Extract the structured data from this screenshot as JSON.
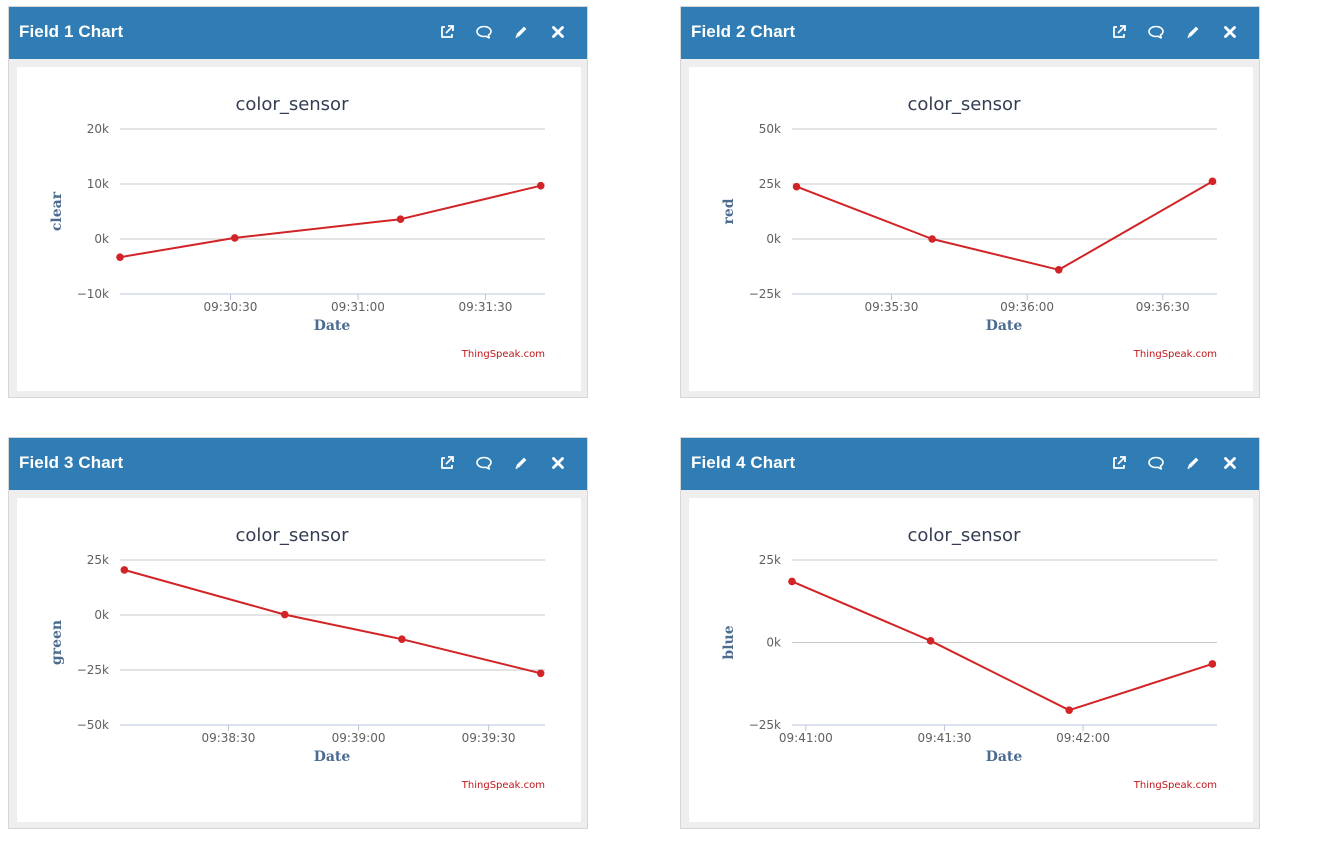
{
  "panels": [
    {
      "title": "Field 1 Chart",
      "actions": [
        {
          "icon": "external-link-icon"
        },
        {
          "icon": "comment-icon"
        },
        {
          "icon": "pencil-icon"
        },
        {
          "icon": "close-icon"
        }
      ]
    },
    {
      "title": "Field 2 Chart",
      "actions": [
        {
          "icon": "external-link-icon"
        },
        {
          "icon": "comment-icon"
        },
        {
          "icon": "pencil-icon"
        },
        {
          "icon": "close-icon"
        }
      ]
    },
    {
      "title": "Field 3 Chart",
      "actions": [
        {
          "icon": "external-link-icon"
        },
        {
          "icon": "comment-icon"
        },
        {
          "icon": "pencil-icon"
        },
        {
          "icon": "close-icon"
        }
      ]
    },
    {
      "title": "Field 4 Chart",
      "actions": [
        {
          "icon": "external-link-icon"
        },
        {
          "icon": "comment-icon"
        },
        {
          "icon": "pencil-icon"
        },
        {
          "icon": "close-icon"
        }
      ]
    }
  ],
  "colors": {
    "header": "#2f7db4",
    "series": "#d22327",
    "grid": "#c8c8c8",
    "credit": "#c0161a"
  },
  "chart_data": [
    {
      "type": "line",
      "title": "color_sensor",
      "xlabel": "Date",
      "ylabel": "clear",
      "credit": "ThingSpeak.com",
      "grid": true,
      "legend": "none",
      "x_domain": [
        "09:30:04",
        "09:31:44"
      ],
      "xticks": [
        {
          "value": "09:30:30",
          "label": "09:30:30"
        },
        {
          "value": "09:31:00",
          "label": "09:31:00"
        },
        {
          "value": "09:31:30",
          "label": "09:31:30"
        }
      ],
      "ylim": [
        -10000,
        20000
      ],
      "yticks": [
        {
          "value": 20000,
          "label": "20k"
        },
        {
          "value": 10000,
          "label": "10k"
        },
        {
          "value": 0,
          "label": "0k"
        },
        {
          "value": -10000,
          "label": "−10k"
        }
      ],
      "points": [
        {
          "x": "09:30:04",
          "y": -3300
        },
        {
          "x": "09:30:31",
          "y": 200
        },
        {
          "x": "09:31:10",
          "y": 3600
        },
        {
          "x": "09:31:43",
          "y": 9700
        }
      ]
    },
    {
      "type": "line",
      "title": "color_sensor",
      "xlabel": "Date",
      "ylabel": "red",
      "credit": "ThingSpeak.com",
      "grid": true,
      "legend": "none",
      "x_domain": [
        "09:35:08",
        "09:36:42"
      ],
      "xticks": [
        {
          "value": "09:35:30",
          "label": "09:35:30"
        },
        {
          "value": "09:36:00",
          "label": "09:36:00"
        },
        {
          "value": "09:36:30",
          "label": "09:36:30"
        }
      ],
      "ylim": [
        -25000,
        50000
      ],
      "yticks": [
        {
          "value": 50000,
          "label": "50k"
        },
        {
          "value": 25000,
          "label": "25k"
        },
        {
          "value": 0,
          "label": "0k"
        },
        {
          "value": -25000,
          "label": "−25k"
        }
      ],
      "points": [
        {
          "x": "09:35:09",
          "y": 23800
        },
        {
          "x": "09:35:39",
          "y": 0
        },
        {
          "x": "09:36:07",
          "y": -14000
        },
        {
          "x": "09:36:41",
          "y": 26200
        }
      ]
    },
    {
      "type": "line",
      "title": "color_sensor",
      "xlabel": "Date",
      "ylabel": "green",
      "credit": "ThingSpeak.com",
      "grid": true,
      "legend": "none",
      "x_domain": [
        "09:38:05",
        "09:39:43"
      ],
      "xticks": [
        {
          "value": "09:38:30",
          "label": "09:38:30"
        },
        {
          "value": "09:39:00",
          "label": "09:39:00"
        },
        {
          "value": "09:39:30",
          "label": "09:39:30"
        }
      ],
      "ylim": [
        -50000,
        25000
      ],
      "yticks": [
        {
          "value": 25000,
          "label": "25k"
        },
        {
          "value": 0,
          "label": "0k"
        },
        {
          "value": -25000,
          "label": "−25k"
        },
        {
          "value": -50000,
          "label": "−50k"
        }
      ],
      "points": [
        {
          "x": "09:38:06",
          "y": 20500
        },
        {
          "x": "09:38:43",
          "y": 200
        },
        {
          "x": "09:39:10",
          "y": -11000
        },
        {
          "x": "09:39:42",
          "y": -26500
        }
      ]
    },
    {
      "type": "line",
      "title": "color_sensor",
      "xlabel": "Date",
      "ylabel": "blue",
      "credit": "ThingSpeak.com",
      "grid": true,
      "legend": "none",
      "x_domain": [
        "09:40:57",
        "09:42:29"
      ],
      "xticks": [
        {
          "value": "09:41:00",
          "label": "09:41:00"
        },
        {
          "value": "09:41:30",
          "label": "09:41:30"
        },
        {
          "value": "09:42:00",
          "label": "09:42:00"
        }
      ],
      "ylim": [
        -25000,
        25000
      ],
      "yticks": [
        {
          "value": 25000,
          "label": "25k"
        },
        {
          "value": 0,
          "label": "0k"
        },
        {
          "value": -25000,
          "label": "−25k"
        }
      ],
      "points": [
        {
          "x": "09:40:57",
          "y": 18500
        },
        {
          "x": "09:41:27",
          "y": 500
        },
        {
          "x": "09:41:57",
          "y": -20500
        },
        {
          "x": "09:42:28",
          "y": -6500
        }
      ]
    }
  ]
}
